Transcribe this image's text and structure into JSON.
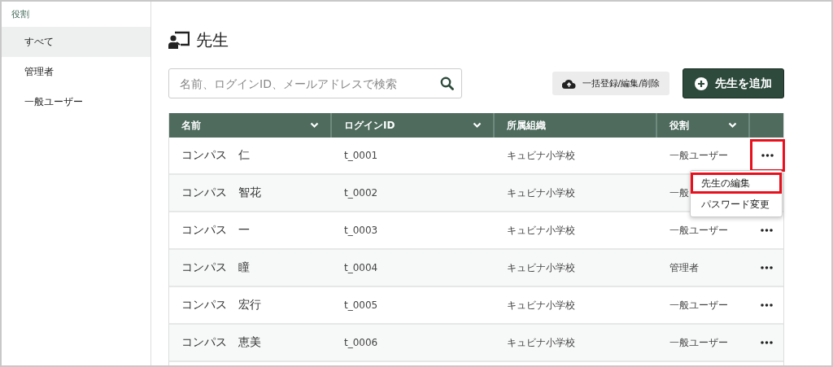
{
  "sidebar": {
    "heading": "役割",
    "items": [
      {
        "label": "すべて",
        "selected": true
      },
      {
        "label": "管理者",
        "selected": false
      },
      {
        "label": "一般ユーザー",
        "selected": false
      }
    ]
  },
  "page": {
    "title": "先生"
  },
  "search": {
    "placeholder": "名前、ログインID、メールアドレスで検索"
  },
  "buttons": {
    "bulk": "一括登録/編集/削除",
    "add": "先生を追加"
  },
  "table": {
    "columns": [
      {
        "label": "名前",
        "dropdown": true
      },
      {
        "label": "ログインID",
        "dropdown": true
      },
      {
        "label": "所属組織",
        "dropdown": false
      },
      {
        "label": "役割",
        "dropdown": true
      }
    ],
    "rows": [
      {
        "name": "コンパス　仁",
        "login_id": "t_0001",
        "organization": "キュビナ小学校",
        "role": "一般ユーザー",
        "highlighted": true,
        "more_button": true
      },
      {
        "name": "コンパス　智花",
        "login_id": "t_0002",
        "organization": "キュビナ小学校",
        "role": "一般",
        "more_button": false
      },
      {
        "name": "コンパス　一",
        "login_id": "t_0003",
        "organization": "キュビナ小学校",
        "role": "一般ユーザー",
        "highlighted": false,
        "more_button": true
      },
      {
        "name": "コンパス　瞳",
        "login_id": "t_0004",
        "organization": "キュビナ小学校",
        "role": "管理者",
        "highlighted": false,
        "more_button": true
      },
      {
        "name": "コンパス　宏行",
        "login_id": "t_0005",
        "organization": "キュビナ小学校",
        "role": "一般ユーザー",
        "highlighted": false,
        "more_button": true
      },
      {
        "name": "コンパス　恵美",
        "login_id": "t_0006",
        "organization": "キュビナ小学校",
        "role": "一般ユーザー",
        "highlighted": false,
        "more_button": true
      }
    ]
  },
  "row_menu": {
    "items": [
      {
        "label": "先生の編集",
        "highlighted": true
      },
      {
        "label": "パスワード変更",
        "highlighted": false
      }
    ]
  }
}
